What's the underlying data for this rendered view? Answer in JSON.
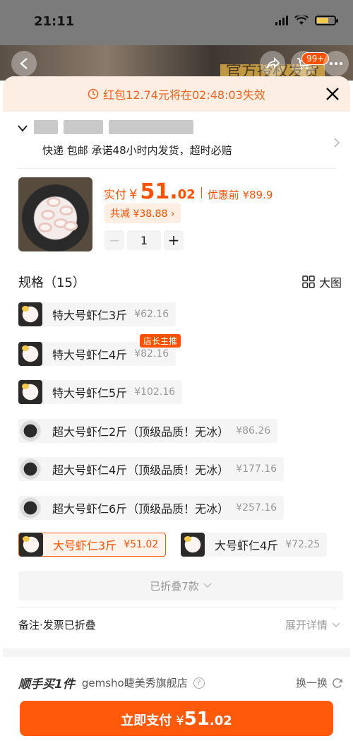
{
  "status_bar": {
    "time": "21:11"
  },
  "header": {
    "cart_badge": "99+",
    "hero_tag": "官方授权发货"
  },
  "coupon_bar": {
    "text": "红包12.74元将在02:48:03失效"
  },
  "address": {
    "delivery": "快递 包邮 承诺48小时内发货，超时必赔"
  },
  "product": {
    "price_label": "实付",
    "yen": "¥",
    "price_int": "51.",
    "price_dec": "02",
    "orig_price": "优惠前 ¥89.9",
    "savings": "共减 ¥38.88 ›",
    "quantity": "1",
    "minus": "−",
    "plus": "+"
  },
  "spec": {
    "title": "规格（15）",
    "big_image": "大图",
    "options": [
      {
        "name": "特大号虾仁3斤",
        "price": "¥62.16",
        "thumb": "a"
      },
      {
        "name": "特大号虾仁4斤",
        "price": "¥82.16",
        "thumb": "a",
        "badge": "店长主推"
      },
      {
        "name": "特大号虾仁5斤",
        "price": "¥102.16",
        "thumb": "a"
      },
      {
        "name": "超大号虾仁2斤（顶级品质！无冰）",
        "price": "¥86.26",
        "thumb": "b"
      },
      {
        "name": "超大号虾仁4斤（顶级品质！无冰）",
        "price": "¥177.16",
        "thumb": "b"
      },
      {
        "name": "超大号虾仁6斤（顶级品质！无冰）",
        "price": "¥257.16",
        "thumb": "b"
      },
      {
        "name": "大号虾仁3斤",
        "price": "¥51.02",
        "thumb": "a",
        "selected": true
      },
      {
        "name": "大号虾仁4斤",
        "price": "¥72.25",
        "thumb": "a"
      }
    ],
    "folded": "已折叠7款"
  },
  "note": {
    "label": "备注·发票已折叠",
    "expand": "展开详情"
  },
  "addon": {
    "title": "顺手买1件",
    "shop": "gemsho睫美秀旗舰店",
    "swap": "换一换"
  },
  "pay": {
    "label": "立即支付",
    "yen": "¥",
    "int": "51",
    "dec": ".02"
  },
  "colors": {
    "accent": "#ff5000",
    "coupon_bg": "#fdeee3",
    "chip_bg": "#f5f5f5"
  }
}
